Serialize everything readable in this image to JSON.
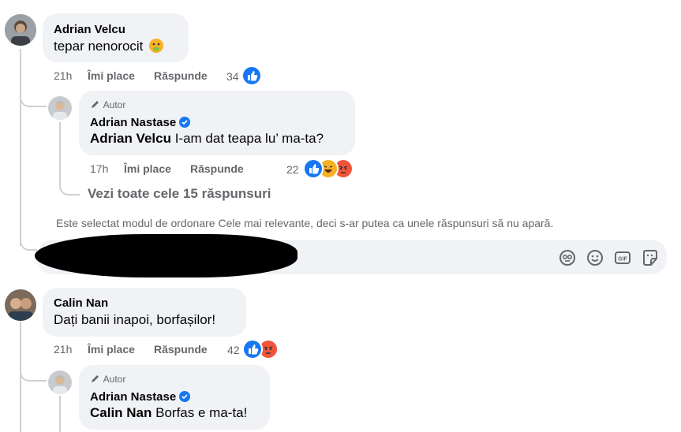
{
  "comments": [
    {
      "author": "Adrian Velcu",
      "text": "tepar nenorocit",
      "time": "21h",
      "like_label": "Îmi place",
      "reply_label": "Răspunde",
      "reaction_count": "34",
      "reply": {
        "badge": "Autor",
        "author": "Adrian Nastase",
        "mention": "Adrian Velcu",
        "text": " I-am dat teapa lu’ ma-ta?",
        "time": "17h",
        "like_label": "Îmi place",
        "reply_label": "Răspunde",
        "reaction_count": "22"
      },
      "view_all": "Vezi toate cele 15 răspunsuri"
    },
    {
      "author": "Calin Nan",
      "text": "Dați banii inapoi, borfașilor!",
      "time": "21h",
      "like_label": "Îmi place",
      "reply_label": "Răspunde",
      "reaction_count": "42",
      "reply": {
        "badge": "Autor",
        "author": "Adrian Nastase",
        "mention": "Calin Nan",
        "text": " Borfas e ma-ta!"
      }
    }
  ],
  "sort_notice": "Este selectat modul de ordonare Cele mai relevante, deci s-ar putea ca unele răspunsuri să nu apară.",
  "icons": [
    "sticker-icon",
    "emoji-icon",
    "gif-icon",
    "avatar-sticker-icon",
    "like-icon",
    "haha-icon",
    "angry-icon",
    "verified-icon",
    "pencil-icon",
    "nauseated-emoji-icon"
  ],
  "colors": {
    "like_blue": "#1877f2",
    "bubble_bg": "#f0f2f5",
    "meta_gray": "#65676b",
    "angry": "#f0553a",
    "haha": "#f7b125"
  }
}
